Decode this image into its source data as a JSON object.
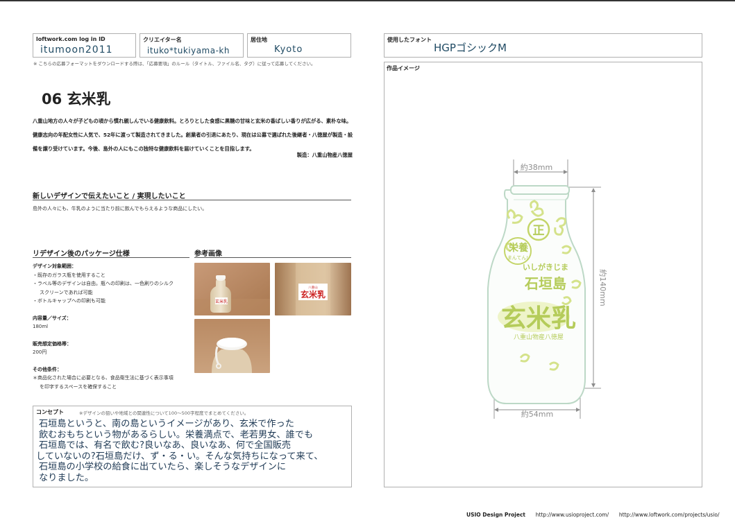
{
  "header": {
    "login_label": "loftwork.com log in ID",
    "login_value": "itumoon2011",
    "creator_label": "クリエイター名",
    "creator_value": "ituko*tukiyama-kh",
    "residence_label": "居住地",
    "residence_value": "Kyoto",
    "font_label": "使用したフォント",
    "font_value": "HGPゴシックM"
  },
  "note": "※ こちらの応募フォーマットをダウンロードする際は、「応募要項」のルール（タイトル、ファイル名、タグ）に従って応募してください。",
  "title": "06 玄米乳",
  "description": "八重山地方の人々が子どもの頃から慣れ親しんでいる健康飲料。とろりとした食感に黒糖の甘味と玄米の香ばしい香りが広がる、素朴な味。健康志向の年配女性に人気で、52年に渡って製造されてきました。創業者の引退にあたり、現在は公募で選ばれた後継者・八徳屋が製造・設備を譲り受けています。今後、島外の人にもこの独特な健康飲料を届けていくことを目指します。",
  "maker": "製造：八重山物産八徳屋",
  "sections": {
    "wish_heading": "新しいデザインで伝えたいこと / 実現したいこと",
    "wish_text": "島外の人々にも、牛乳のように当たり前に飲んでもらえるような商品にしたい。",
    "spec_heading": "リデザイン後のパッケージ仕様",
    "ref_heading": "参考画像"
  },
  "spec": {
    "scope_heading": "デザイン対象範囲：",
    "scope_items": [
      "・既存のガラス瓶を使用すること",
      "・ラベル等のデザインは自由。瓶への印刷は、一色刷りのシルク",
      "スクリーンであれば可能",
      "・ボトルキャップへの印刷も可能"
    ],
    "volume_heading": "内容量／サイズ：",
    "volume_value": "180ml",
    "price_heading": "販売想定価格帯：",
    "price_value": "200円",
    "other_heading": "その他条件：",
    "other_items": [
      "＊商品化された場合に必要となる、食品衛生法に基づく表示事項",
      "を印字するスペースを確保すること"
    ]
  },
  "concept": {
    "label": "コンセプト",
    "sub": "※デザインの狙いや地域との関連性について100〜500字程度でまとめてください。",
    "lines": [
      "石垣島というと、南の島というイメージがあり、玄米で作った",
      "飲むおもちという物があるらしい。栄養満点で、老若男女、誰でも",
      "石垣島では、有名で飲む?良いなあ、良いなあ、何で全国販売",
      "していないの?石垣島だけ、ず・る・い。そんな気持ちになって来て、",
      "石垣島の小学校の給食に出ていたら、楽しそうなデザインに",
      "なりました。"
    ]
  },
  "artwork": {
    "label": "作品イメージ",
    "dim_top": "約38mm",
    "dim_right": "約140mm",
    "dim_bottom": "約54mm",
    "seal": "正",
    "badge_top": "栄養",
    "badge_sub": "まんてん!",
    "hira": "いしがきじま",
    "island": "石垣島",
    "product": "玄米乳",
    "maker": "八重山物産八徳屋"
  },
  "photos": {
    "p1_label": "玄米乳",
    "p2_small": "八重山",
    "p2_label": "玄米乳"
  },
  "footer": {
    "project": "USIO Design Project",
    "url1": "http://www.usioproject.com/",
    "url2": "http://www.loftwork.com/projects/usio/"
  },
  "colors": {
    "value_text": "#1f4a63",
    "bottle_outline": "#bcd8c6",
    "artwork_green": "#b5cc5a",
    "dimension": "#8d8d8d"
  }
}
